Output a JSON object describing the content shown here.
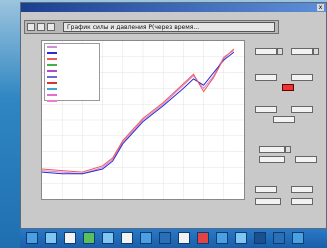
{
  "window": {
    "title": "",
    "close_label": "x"
  },
  "plot": {
    "title_field": "График силы и давления Р(через время..."
  },
  "legend": {
    "series": [
      {
        "name": "",
        "color": "#d48ad8"
      },
      {
        "name": "",
        "color": "#2b2bcf"
      },
      {
        "name": "",
        "color": "#ee5a5a"
      },
      {
        "name": "",
        "color": "#42b342"
      },
      {
        "name": "",
        "color": "#b24ad0"
      },
      {
        "name": "",
        "color": "#6a6ad0"
      },
      {
        "name": "",
        "color": "#dd3333"
      },
      {
        "name": "",
        "color": "#3aa5d6"
      },
      {
        "name": "",
        "color": "#e070c8"
      },
      {
        "name": "",
        "color": "#f07ad6"
      }
    ]
  },
  "panel": {
    "sections": [
      {
        "label": ""
      },
      {
        "label": ""
      },
      {
        "label": ""
      },
      {
        "label": ""
      },
      {
        "label": ""
      }
    ]
  },
  "taskbar": {
    "icons": [
      {
        "icon": "app-icon",
        "color": "#4aa0e0"
      },
      {
        "icon": "app-icon",
        "color": "#7fc6f2"
      },
      {
        "icon": "app-icon",
        "color": "#f2f2f2"
      },
      {
        "icon": "app-icon",
        "color": "#5bbf5b"
      },
      {
        "icon": "app-icon",
        "color": "#7fc6f2"
      },
      {
        "icon": "app-icon",
        "color": "#f2f2f2"
      },
      {
        "icon": "app-icon",
        "color": "#4aa0e0"
      },
      {
        "icon": "app-icon",
        "color": "#2b6fb8"
      },
      {
        "icon": "app-icon",
        "color": "#f2f2f2"
      },
      {
        "icon": "app-icon",
        "color": "#e24444"
      },
      {
        "icon": "app-icon",
        "color": "#4aa0e0"
      },
      {
        "icon": "app-icon",
        "color": "#7fc6f2"
      },
      {
        "icon": "app-icon",
        "color": "#1b4f8f"
      },
      {
        "icon": "app-icon",
        "color": "#2b6fb8"
      },
      {
        "icon": "app-icon",
        "color": "#4aa0e0"
      }
    ]
  },
  "chart_data": {
    "type": "line",
    "title": "",
    "xlabel": "",
    "ylabel": "",
    "xlim": [
      0,
      100
    ],
    "ylim": [
      0,
      100
    ],
    "grid": true,
    "series": [
      {
        "color": "#d48ad8",
        "x": [
          0,
          10,
          20,
          30,
          35,
          40,
          50,
          60,
          70,
          75,
          80,
          85,
          90,
          95
        ],
        "y": [
          18,
          17,
          16,
          20,
          25,
          36,
          50,
          60,
          72,
          78,
          70,
          78,
          90,
          94
        ]
      },
      {
        "color": "#2b2bcf",
        "x": [
          0,
          10,
          20,
          30,
          35,
          40,
          50,
          60,
          70,
          75,
          80,
          85,
          90,
          95
        ],
        "y": [
          17,
          16,
          16,
          19,
          24,
          35,
          49,
          59,
          70,
          76,
          72,
          80,
          88,
          93
        ]
      },
      {
        "color": "#ee5a5a",
        "x": [
          0,
          10,
          20,
          30,
          35,
          40,
          50,
          60,
          70,
          75,
          80,
          85,
          90,
          95
        ],
        "y": [
          19,
          18,
          17,
          21,
          26,
          37,
          51,
          61,
          73,
          79,
          68,
          77,
          89,
          95
        ]
      }
    ]
  }
}
